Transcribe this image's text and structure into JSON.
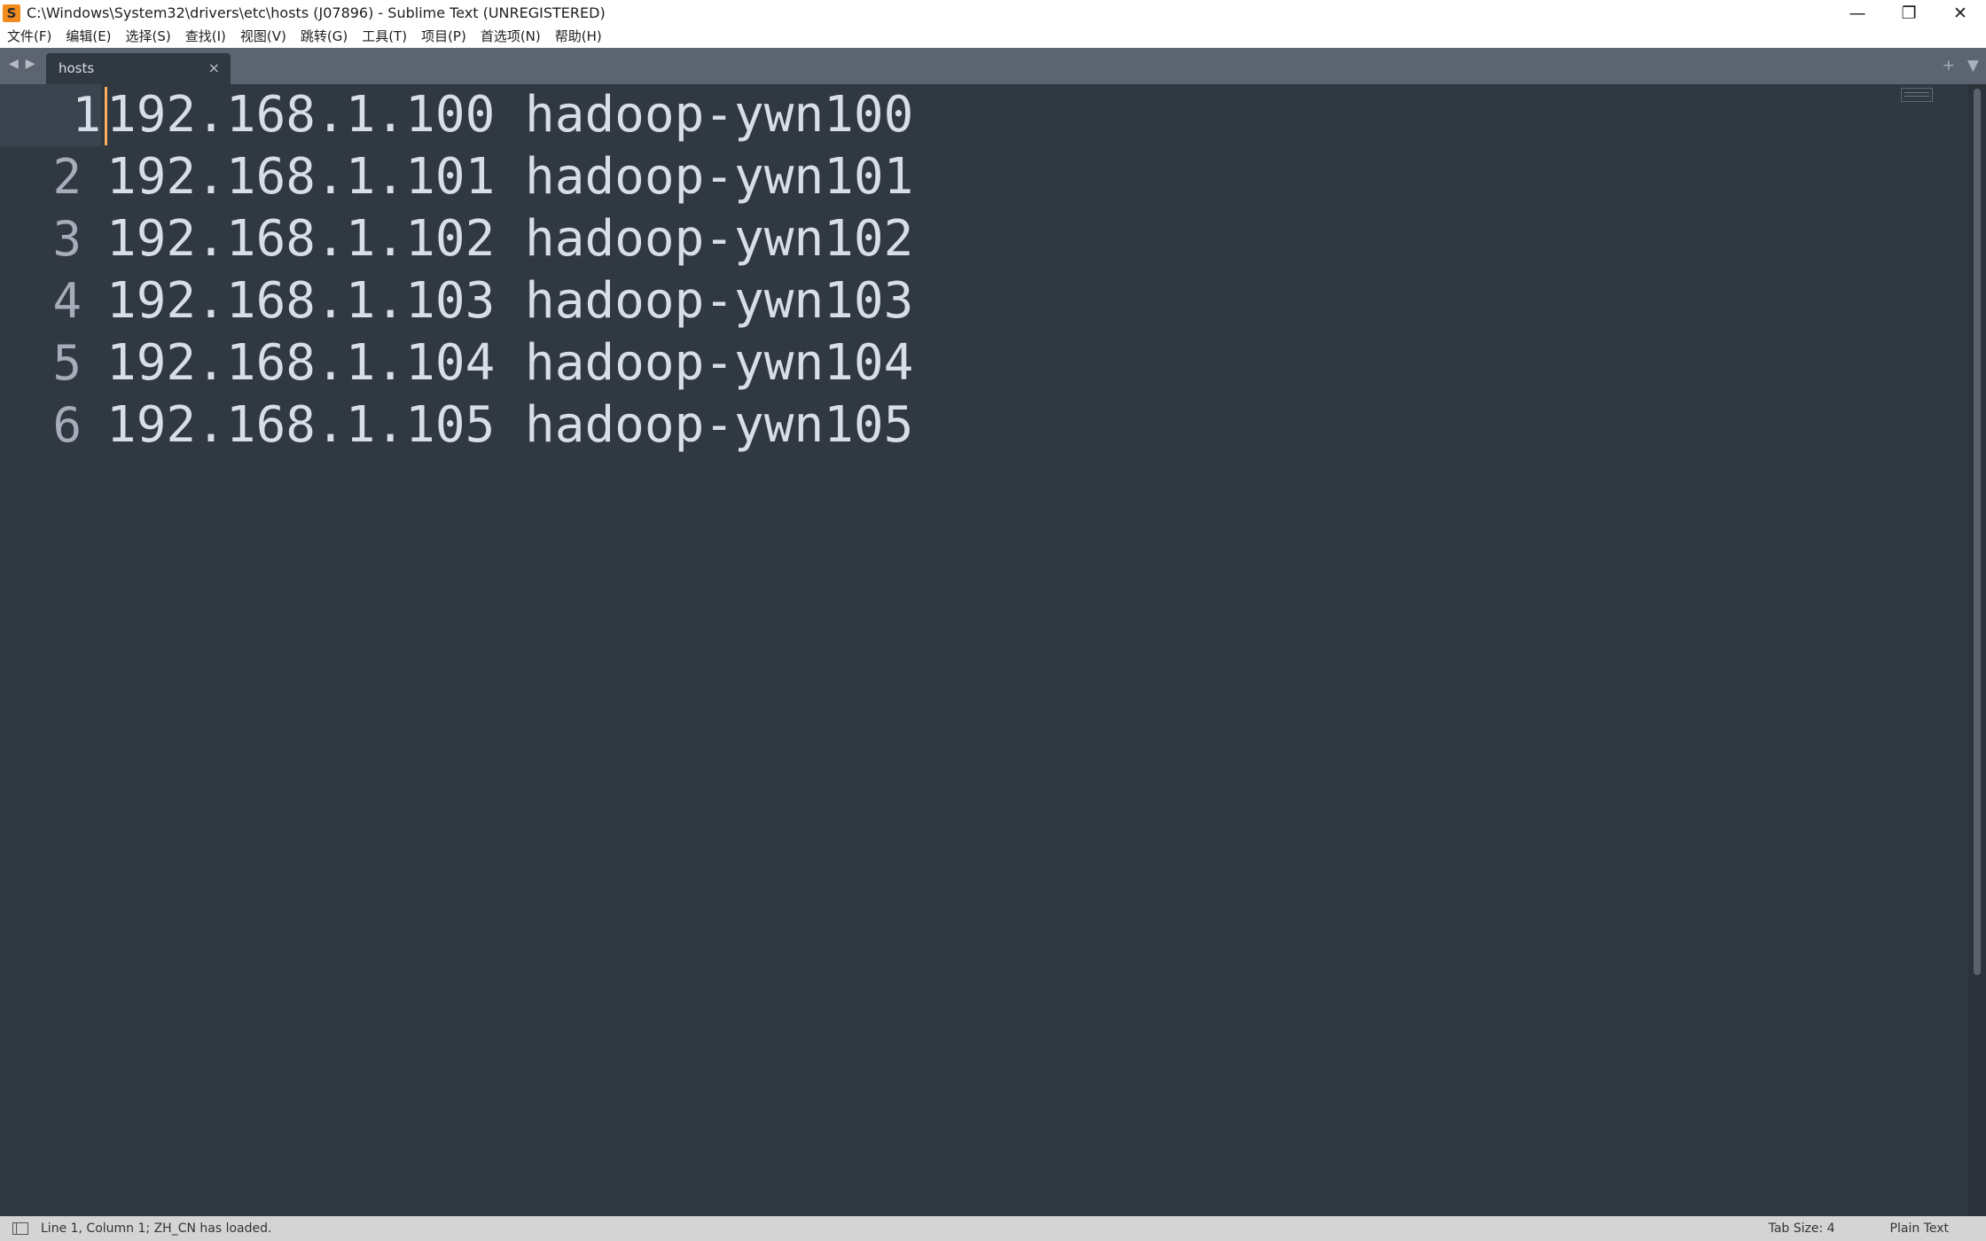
{
  "window": {
    "title": "C:\\Windows\\System32\\drivers\\etc\\hosts (J07896) - Sublime Text (UNREGISTERED)",
    "app_icon_letter": "S",
    "controls": {
      "minimize": "—",
      "restore": "❐",
      "close": "✕"
    }
  },
  "menu": {
    "items": [
      "文件(F)",
      "编辑(E)",
      "选择(S)",
      "查找(I)",
      "视图(V)",
      "跳转(G)",
      "工具(T)",
      "项目(P)",
      "首选项(N)",
      "帮助(H)"
    ]
  },
  "tabs": {
    "nav_left": "◀",
    "nav_right": "▶",
    "active_tab": {
      "label": "hosts",
      "close": "×"
    },
    "new_tab": "+",
    "tab_menu": "▼"
  },
  "editor": {
    "lines": [
      {
        "num": "1",
        "text": "192.168.1.100 hadoop-ywn100"
      },
      {
        "num": "2",
        "text": "192.168.1.101 hadoop-ywn101"
      },
      {
        "num": "3",
        "text": "192.168.1.102 hadoop-ywn102"
      },
      {
        "num": "4",
        "text": "192.168.1.103 hadoop-ywn103"
      },
      {
        "num": "5",
        "text": "192.168.1.104 hadoop-ywn104"
      },
      {
        "num": "6",
        "text": "192.168.1.105 hadoop-ywn105"
      }
    ],
    "active_line": 1,
    "colors": {
      "background": "#303841",
      "text": "#d8dee9",
      "cursor": "#f9ae58"
    }
  },
  "status": {
    "message": "Line 1, Column 1; ZH_CN has loaded.",
    "tab_size": "Tab Size: 4",
    "syntax": "Plain Text"
  }
}
